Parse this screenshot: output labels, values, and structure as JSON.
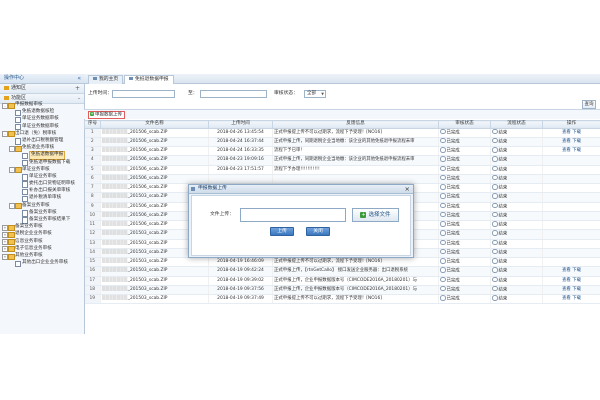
{
  "sidebar": {
    "title": "操作中心",
    "collapse_glyph": "«",
    "sections": [
      {
        "label": "通知区",
        "toggle": "+"
      },
      {
        "label": "功能区",
        "toggle": "-"
      }
    ],
    "tree": [
      {
        "label": "申报数据审核",
        "level": 0,
        "type": "folder",
        "toggle": "-"
      },
      {
        "label": "免抵退数据核检",
        "level": 1,
        "type": "page"
      },
      {
        "label": "单证业务数据审核",
        "level": 1,
        "type": "page"
      },
      {
        "label": "单证业务数据审核",
        "level": 1,
        "type": "page"
      },
      {
        "label": "出口退（免）税审核",
        "level": 0,
        "type": "folder",
        "toggle": "-"
      },
      {
        "label": "退补出口税税额管理",
        "level": 1,
        "type": "page"
      },
      {
        "label": "免抵退业务审核",
        "level": 1,
        "type": "folder",
        "toggle": "-"
      },
      {
        "label": "免抵退数据申报",
        "level": 2,
        "type": "page",
        "selected": true
      },
      {
        "label": "免抵退申报数据下载",
        "level": 2,
        "type": "page"
      },
      {
        "label": "单证业务审核",
        "level": 1,
        "type": "folder",
        "toggle": "-"
      },
      {
        "label": "单证业务审核",
        "level": 2,
        "type": "page"
      },
      {
        "label": "委托出口货物证明审核",
        "level": 2,
        "type": "page"
      },
      {
        "label": "补办出口报关单审核",
        "level": 2,
        "type": "page"
      },
      {
        "label": "退补税清单审核",
        "level": 2,
        "type": "page"
      },
      {
        "label": "备案业务审核",
        "level": 1,
        "type": "folder",
        "toggle": "-"
      },
      {
        "label": "备案业务审核",
        "level": 2,
        "type": "page"
      },
      {
        "label": "备案业务审核结果下",
        "level": 2,
        "type": "page"
      },
      {
        "label": "备案业务审核",
        "level": 0,
        "type": "folder",
        "toggle": "+"
      },
      {
        "label": "退税企业业务审核",
        "level": 0,
        "type": "folder",
        "toggle": "+"
      },
      {
        "label": "信息业务审核",
        "level": 0,
        "type": "folder",
        "toggle": "+"
      },
      {
        "label": "电子信息业务审核",
        "level": 0,
        "type": "folder",
        "toggle": "+"
      },
      {
        "label": "其他业务审核",
        "level": 0,
        "type": "folder",
        "toggle": "+"
      },
      {
        "label": "其他出口企业业务审核",
        "level": 1,
        "type": "page"
      }
    ]
  },
  "tabs": [
    {
      "label": "我的主页",
      "active": false
    },
    {
      "label": "免抵退数据申报",
      "active": true
    }
  ],
  "filter": {
    "upload_time_label": "上传时间：",
    "to_label": "至：",
    "status_label": "审核状态：",
    "status_value": "全部",
    "query_label": "查询"
  },
  "toolbar": {
    "upload_label": "申报数据上传",
    "upload_glyph": "+"
  },
  "table": {
    "columns": [
      "序号",
      "文件名称",
      "上传时间",
      "反馈信息",
      "审核状态",
      "流程状态",
      "操作"
    ],
    "rows": [
      {
        "no": "1",
        "name": "_201506_scab.ZIP",
        "time": "2018-04-26 13:45:54",
        "msg": "正式申报提上传不可以过期求，流程下予受理！[NO16]",
        "audit": "已完成",
        "flow": "结束",
        "ops": "查看  下载"
      },
      {
        "no": "2",
        "name": "_201506_scab.ZIP",
        "time": "2018-04-24 16:37:44",
        "msg": "正式申报上传，同期退税企业当地缴：该企业的其他免抵退申报流程未审",
        "audit": "已完成",
        "flow": "结束",
        "ops": "查看  下载"
      },
      {
        "no": "3",
        "name": "_201506_scab.ZIP",
        "time": "2018-04-24 16:33:35",
        "msg": "流程下予已审！",
        "audit": "已完成",
        "flow": "结束",
        "ops": "查看  下载"
      },
      {
        "no": "4",
        "name": "_201506_scab.ZIP",
        "time": "2018-04-23 19:09:16",
        "msg": "正式申报上传，同期退税企业当地缴：该企业的其他免抵退申报流程未审",
        "audit": "已完成",
        "flow": "结束",
        "ops": ""
      },
      {
        "no": "5",
        "name": "_201506_scab.ZIP",
        "time": "2018-04-23 17:51:57",
        "msg": "流程下予办理!!!!!!!!!!!",
        "audit": "已完成",
        "flow": "结束",
        "ops": ""
      },
      {
        "no": "6",
        "name": "_201506_scab.ZIP",
        "time": "",
        "msg": "",
        "audit": "已完成",
        "flow": "结束",
        "ops": ""
      },
      {
        "no": "7",
        "name": "_201506_scab.ZIP",
        "time": "",
        "msg": "",
        "audit": "已完成",
        "flow": "结束",
        "ops": ""
      },
      {
        "no": "8",
        "name": "_201503_scab.ZIP",
        "time": "",
        "msg": "",
        "audit": "已完成",
        "flow": "结束",
        "ops": ""
      },
      {
        "no": "9",
        "name": "_201506_scab.ZIP",
        "time": "",
        "msg": "",
        "audit": "已完成",
        "flow": "结束",
        "ops": ""
      },
      {
        "no": "10",
        "name": "_201506_scab.ZIP",
        "time": "",
        "msg": "",
        "audit": "已完成",
        "flow": "结束",
        "ops": ""
      },
      {
        "no": "11",
        "name": "_201506_scab.ZIP",
        "time": "",
        "msg": "",
        "audit": "已完成",
        "flow": "结束",
        "ops": ""
      },
      {
        "no": "12",
        "name": "_201503_scab.ZIP",
        "time": "",
        "msg": "",
        "audit": "已完成",
        "flow": "结束",
        "ops": ""
      },
      {
        "no": "13",
        "name": "_201503_scab.ZIP",
        "time": "",
        "msg": "",
        "audit": "已完成",
        "flow": "结束",
        "ops": ""
      },
      {
        "no": "14",
        "name": "_201503_scab.ZIP",
        "time": "",
        "msg": "",
        "audit": "已完成",
        "flow": "结束",
        "ops": ""
      },
      {
        "no": "15",
        "name": "_201503_scab.ZIP",
        "time": "2018-04-19 16:46:09",
        "msg": "正式申报提上传不可以过期求，流程下予受理！[NO16]",
        "audit": "已完成",
        "flow": "结束",
        "ops": ""
      },
      {
        "no": "16",
        "name": "_201503_scab.ZIP",
        "time": "2018-04-19 09:42:24",
        "msg": "正式申报上传，【rtnGetCallo】 接口发送企业服务器：出口退税系统",
        "audit": "已完成",
        "flow": "结束",
        "ops": "查看  下载"
      },
      {
        "no": "17",
        "name": "_201503_scab.ZIP",
        "time": "2018-04-19 09:39:02",
        "msg": "正式申报上传，企业申报数据版本号（CIMCODE2016A_20180201）与",
        "audit": "已完成",
        "flow": "结束",
        "ops": "查看  下载"
      },
      {
        "no": "18",
        "name": "_201503_scab.ZIP",
        "time": "2018-04-19 09:37:56",
        "msg": "正式申报上传，企业申报数据版本号（CIMCODE2016A_20180201）与",
        "audit": "已完成",
        "flow": "结束",
        "ops": "查看  下载"
      },
      {
        "no": "19",
        "name": "_201503_scab.ZIP",
        "time": "2018-04-19 09:37:49",
        "msg": "正式申报提上传不可以过期求，流程下予受理！[NO16]",
        "audit": "已完成",
        "flow": "结束",
        "ops": "查看  下载"
      }
    ]
  },
  "dialog": {
    "title": "申报数据上传",
    "close_glyph": "×",
    "file_label": "文件上传：",
    "file_value": "",
    "choose_label": "选择文件",
    "choose_glyph": "+",
    "upload_btn": "上传",
    "close_btn": "关闭"
  }
}
